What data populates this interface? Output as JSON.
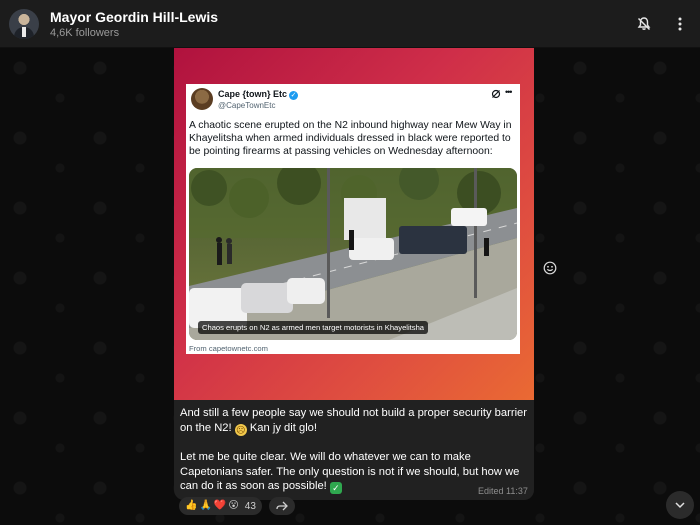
{
  "header": {
    "channel_name": "Mayor Geordin Hill-Lewis",
    "subscribers": "4,6K followers"
  },
  "tweet": {
    "author_name": "Cape {town} Etc",
    "author_handle": "@CapeTownEtc",
    "text": "A chaotic scene erupted on the N2 inbound highway near Mew Way in Khayelitsha when armed individuals dressed in black were reported to be pointing firearms at passing vehicles on Wednesday afternoon:",
    "image_caption": "Chaos erupts on N2 as armed men target motorists in Khayelitsha",
    "source": "From capetownetc.com"
  },
  "message": {
    "paragraph1": "And still a few people say we should not build a proper security barrier on the N2! ",
    "paragraph1_tail": " Kan jy dit glo!",
    "paragraph2": "Let me be quite clear. We will do whatever we can to make Capetonians safer. The only question is not if we should, but how we can do it as soon as possible! ",
    "time": "Edited 11:37"
  },
  "reactions": {
    "count": "43",
    "icons": [
      "👍",
      "🙏",
      "❤️",
      "😮"
    ]
  },
  "colors": {
    "header_bg": "#1c1c1c",
    "bubble_bg": "#212121",
    "accent_gradient_start": "#b0123e",
    "accent_gradient_end": "#ea6a33",
    "verified_badge": "#1d9bf0"
  }
}
